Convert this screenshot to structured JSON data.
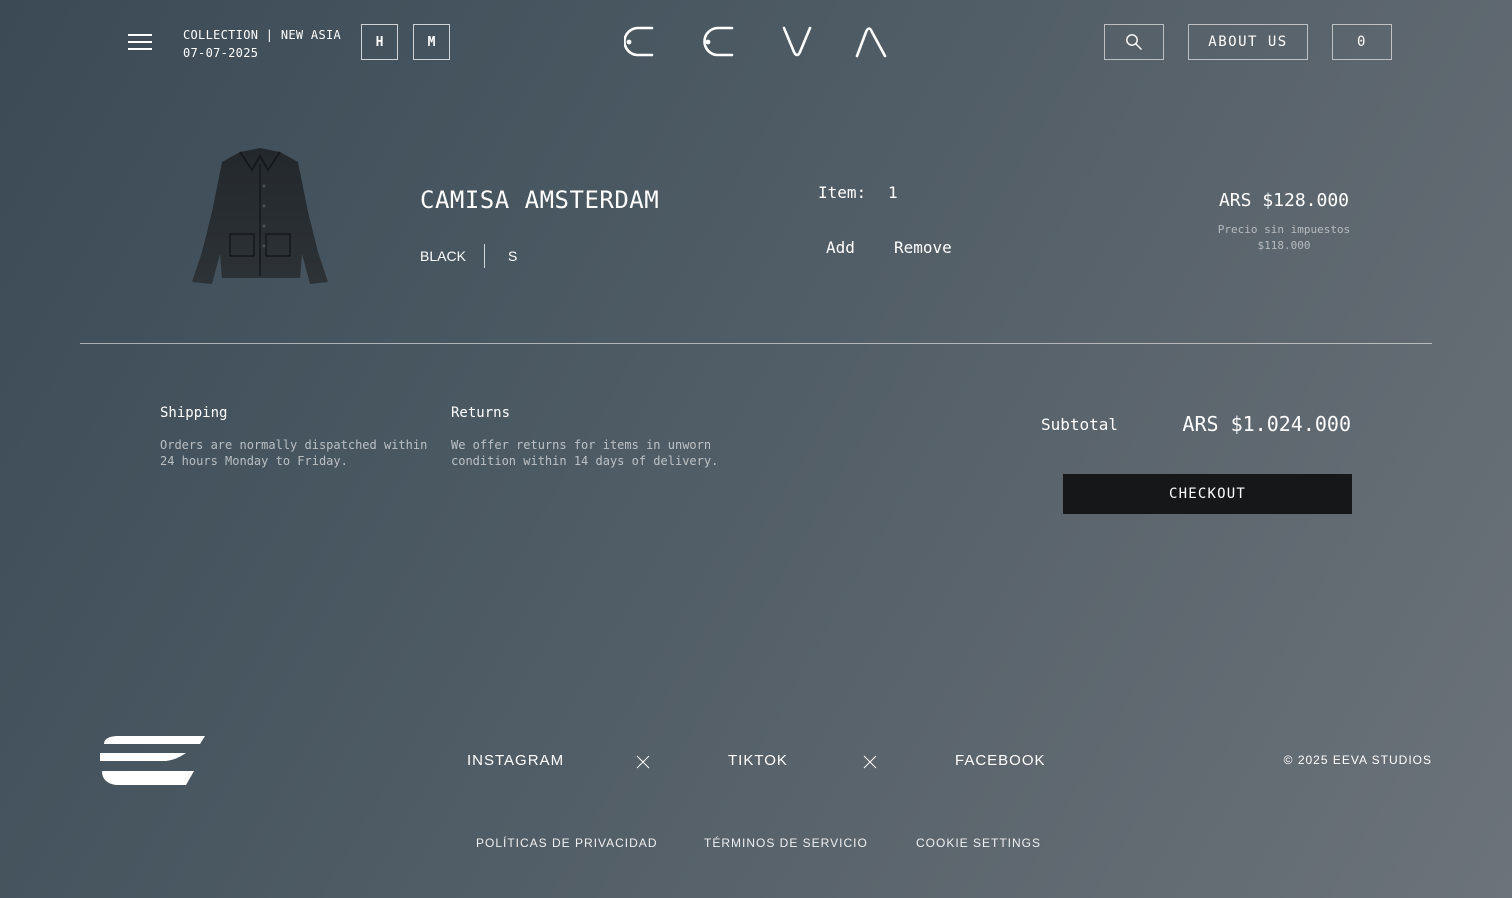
{
  "header": {
    "collection_line": "COLLECTION | NEW ASIA",
    "date": "07-07-2025",
    "toggle_h": "H",
    "toggle_m": "M",
    "brand": "EEVA",
    "about_label": "ABOUT US",
    "cart_count": "0",
    "icons": [
      "menu-icon",
      "search-icon"
    ]
  },
  "cart": {
    "item": {
      "name": "CAMISA AMSTERDAM",
      "color": "BLACK",
      "size": "S",
      "qty_label": "Item:",
      "qty": "1",
      "add_label": "Add",
      "remove_label": "Remove",
      "price": "ARS $128.000",
      "price_no_tax_label": "Precio sin impuestos",
      "price_no_tax": "$118.000"
    }
  },
  "info": {
    "shipping_title": "Shipping",
    "shipping_text": "Orders are normally dispatched within 24 hours Monday to Friday.",
    "returns_title": "Returns",
    "returns_text": "We offer returns for items in unworn condition within 14 days of delivery."
  },
  "summary": {
    "subtotal_label": "Subtotal",
    "subtotal_value": "ARS $1.024.000",
    "checkout_label": "CHECKOUT"
  },
  "footer": {
    "instagram": "INSTAGRAM",
    "tiktok": "TIKTOK",
    "facebook": "FACEBOOK",
    "copyright": "© 2025 EEVA STUDIOS",
    "privacy": "POLÍTICAS DE PRIVACIDAD",
    "terms": "TÉRMINOS DE SERVICIO",
    "cookies": "COOKIE SETTINGS"
  },
  "colors": {
    "background_start": "#3b4a55",
    "background_end": "#6c737a",
    "checkout_bg": "#161718",
    "text": "#ffffff"
  }
}
